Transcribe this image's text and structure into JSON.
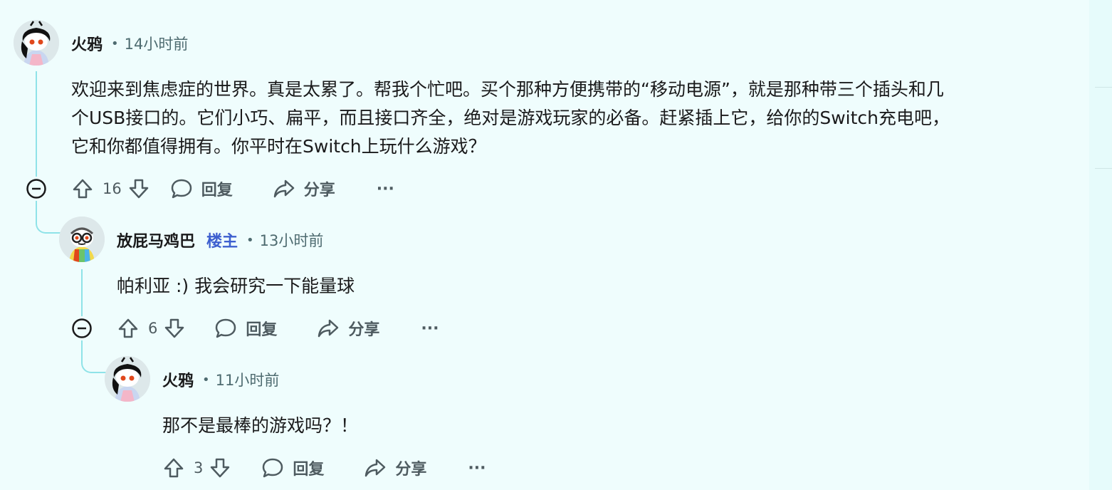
{
  "comments": [
    {
      "author": "火鸦",
      "op_badge": "",
      "time": "14小时前",
      "body_lines": [
        "欢迎来到焦虑症的世界。真是太累了。帮我个忙吧。买个那种方便携带的“移动电源”，就是那种带三个插头和几",
        "个USB接口的。它们小巧、扁平，而且接口齐全，绝对是游戏玩家的必备。赶紧插上它，给你的Switch充电吧，",
        "它和你都值得拥有。你平时在Switch上玩什么游戏？"
      ],
      "score": "16",
      "reply_label": "回复",
      "share_label": "分享",
      "more_label": "···"
    },
    {
      "author": "放屁马鸡巴",
      "op_badge": "楼主",
      "time": "13小时前",
      "body_lines": [
        "帕利亚 :) 我会研究一下能量球"
      ],
      "score": "6",
      "reply_label": "回复",
      "share_label": "分享",
      "more_label": "···"
    },
    {
      "author": "火鸦",
      "op_badge": "",
      "time": "11小时前",
      "body_lines": [
        "那不是最棒的游戏吗？！"
      ],
      "score": "3",
      "reply_label": "回复",
      "share_label": "分享",
      "more_label": "···"
    }
  ],
  "meta_separator": "•",
  "colors": {
    "background": "#effdfd",
    "thread_line": "#8fe3e8",
    "op_badge": "#3d5fcf",
    "muted": "#4e6b70"
  },
  "icons": [
    "upvote-icon",
    "downvote-icon",
    "comment-icon",
    "share-icon",
    "collapse-icon",
    "avatar"
  ]
}
